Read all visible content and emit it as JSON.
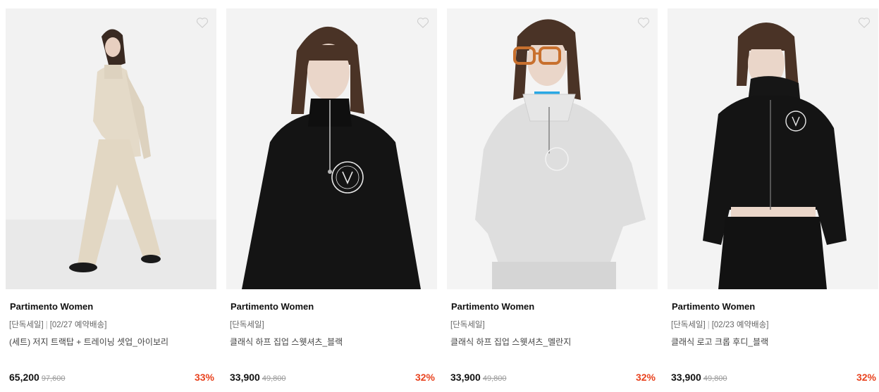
{
  "colors": {
    "discount": "#e8421e",
    "photo_background": "#efefef"
  },
  "products": [
    {
      "brand": "Partimento Women",
      "tags": [
        "[단독세일]",
        "[02/27 예약배송]"
      ],
      "name": "(세트) 저지 트랙탑 + 트레이닝 셋업_아이보리",
      "price": "65,200",
      "original_price": "97,600",
      "discount": "33%",
      "wishlist_icon": "heart-outline-icon",
      "garment_color": "#e6dccb"
    },
    {
      "brand": "Partimento Women",
      "tags": [
        "[단독세일]"
      ],
      "name": "클래식 하프 집업 스웻셔츠_블랙",
      "price": "33,900",
      "original_price": "49,800",
      "discount": "32%",
      "wishlist_icon": "heart-outline-icon",
      "garment_color": "#141414"
    },
    {
      "brand": "Partimento Women",
      "tags": [
        "[단독세일]"
      ],
      "name": "클래식 하프 집업 스웻셔츠_멜란지",
      "price": "33,900",
      "original_price": "49,800",
      "discount": "32%",
      "wishlist_icon": "heart-outline-icon",
      "garment_color": "#dcdcdc"
    },
    {
      "brand": "Partimento Women",
      "tags": [
        "[단독세일]",
        "[02/23 예약배송]"
      ],
      "name": "클래식 로고 크롭 후디_블랙",
      "price": "33,900",
      "original_price": "49,800",
      "discount": "32%",
      "wishlist_icon": "heart-outline-icon",
      "garment_color": "#141414"
    }
  ]
}
